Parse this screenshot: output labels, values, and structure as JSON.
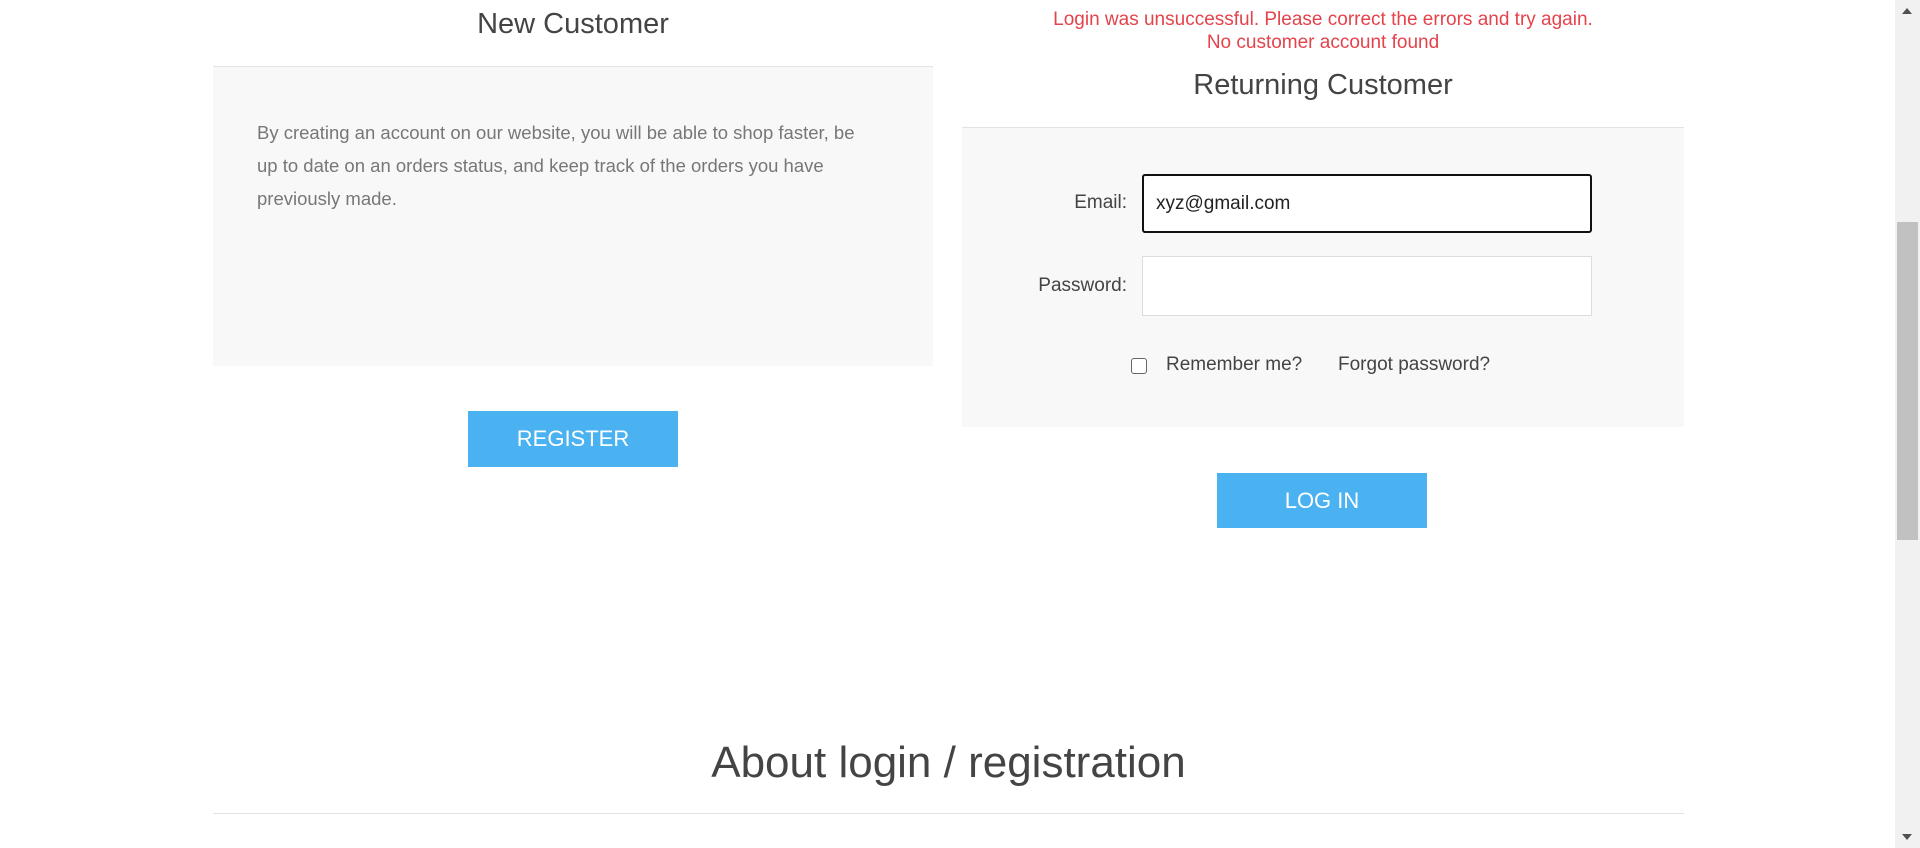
{
  "new_customer": {
    "title": "New Customer",
    "description": "By creating an account on our website, you will be able to shop faster, be up to date on an orders status, and keep track of the orders you have previously made.",
    "register_label": "Register"
  },
  "returning_customer": {
    "errors": [
      "Login was unsuccessful. Please correct the errors and try again.",
      "No customer account found"
    ],
    "title": "Returning Customer",
    "email_label": "Email:",
    "email_value": "xyz@gmail.com",
    "password_label": "Password:",
    "password_value": "",
    "remember_label": "Remember me?",
    "remember_checked": false,
    "forgot_label": "Forgot password?",
    "login_label": "Log in"
  },
  "about": {
    "title": "About login / registration"
  },
  "colors": {
    "accent": "#4ab2f1",
    "error": "#e4434b"
  }
}
